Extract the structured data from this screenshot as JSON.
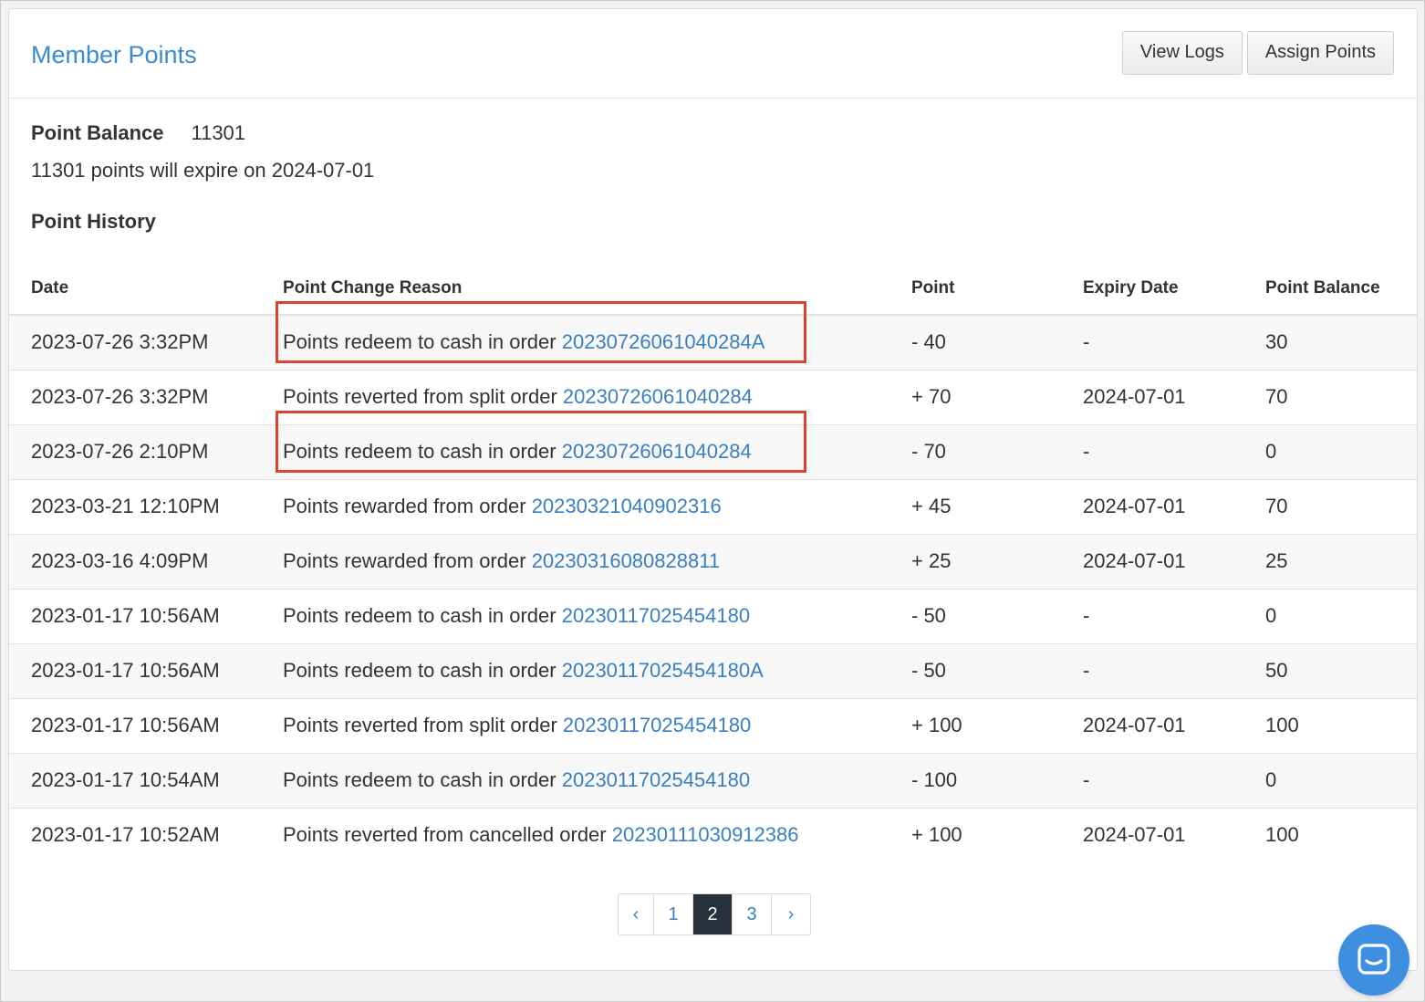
{
  "panel": {
    "title": "Member Points",
    "buttons": {
      "view_logs": "View Logs",
      "assign_points": "Assign Points"
    }
  },
  "balance": {
    "label": "Point Balance",
    "value": "11301",
    "expire_text": "11301 points will expire on 2024-07-01"
  },
  "history": {
    "title": "Point History",
    "columns": [
      "Date",
      "Point Change Reason",
      "Point",
      "Expiry Date",
      "Point Balance"
    ],
    "rows": [
      {
        "date": "2023-07-26 3:32PM",
        "reason": "Points redeem to cash in order",
        "order": "20230726061040284A",
        "point": "- 40",
        "expiry": "-",
        "balance": "30",
        "highlighted": true
      },
      {
        "date": "2023-07-26 3:32PM",
        "reason": "Points reverted from split order",
        "order": "20230726061040284",
        "point": "+ 70",
        "expiry": "2024-07-01",
        "balance": "70",
        "highlighted": false
      },
      {
        "date": "2023-07-26 2:10PM",
        "reason": "Points redeem to cash in order",
        "order": "20230726061040284",
        "point": "- 70",
        "expiry": "-",
        "balance": "0",
        "highlighted": true
      },
      {
        "date": "2023-03-21 12:10PM",
        "reason": "Points rewarded from order",
        "order": "20230321040902316",
        "point": "+ 45",
        "expiry": "2024-07-01",
        "balance": "70",
        "highlighted": false
      },
      {
        "date": "2023-03-16 4:09PM",
        "reason": "Points rewarded from order",
        "order": "20230316080828811",
        "point": "+ 25",
        "expiry": "2024-07-01",
        "balance": "25",
        "highlighted": false
      },
      {
        "date": "2023-01-17 10:56AM",
        "reason": "Points redeem to cash in order",
        "order": "20230117025454180",
        "point": "- 50",
        "expiry": "-",
        "balance": "0",
        "highlighted": false
      },
      {
        "date": "2023-01-17 10:56AM",
        "reason": "Points redeem to cash in order",
        "order": "20230117025454180A",
        "point": "- 50",
        "expiry": "-",
        "balance": "50",
        "highlighted": false
      },
      {
        "date": "2023-01-17 10:56AM",
        "reason": "Points reverted from split order",
        "order": "20230117025454180",
        "point": "+ 100",
        "expiry": "2024-07-01",
        "balance": "100",
        "highlighted": false
      },
      {
        "date": "2023-01-17 10:54AM",
        "reason": "Points redeem to cash in order",
        "order": "20230117025454180",
        "point": "- 100",
        "expiry": "-",
        "balance": "0",
        "highlighted": false
      },
      {
        "date": "2023-01-17 10:52AM",
        "reason": "Points reverted from cancelled order",
        "order": "20230111030912386",
        "point": "+ 100",
        "expiry": "2024-07-01",
        "balance": "100",
        "highlighted": false
      }
    ]
  },
  "pagination": {
    "prev": "‹",
    "pages": [
      "1",
      "2",
      "3"
    ],
    "active": "2",
    "next": "›"
  },
  "chat": {
    "icon": "chat-bubble-icon"
  },
  "colors": {
    "link": "#3a7fc0",
    "title": "#3a8bcd",
    "highlight_border": "#d9432f",
    "active_page": "#26313b",
    "chat": "#3e8fe0"
  }
}
